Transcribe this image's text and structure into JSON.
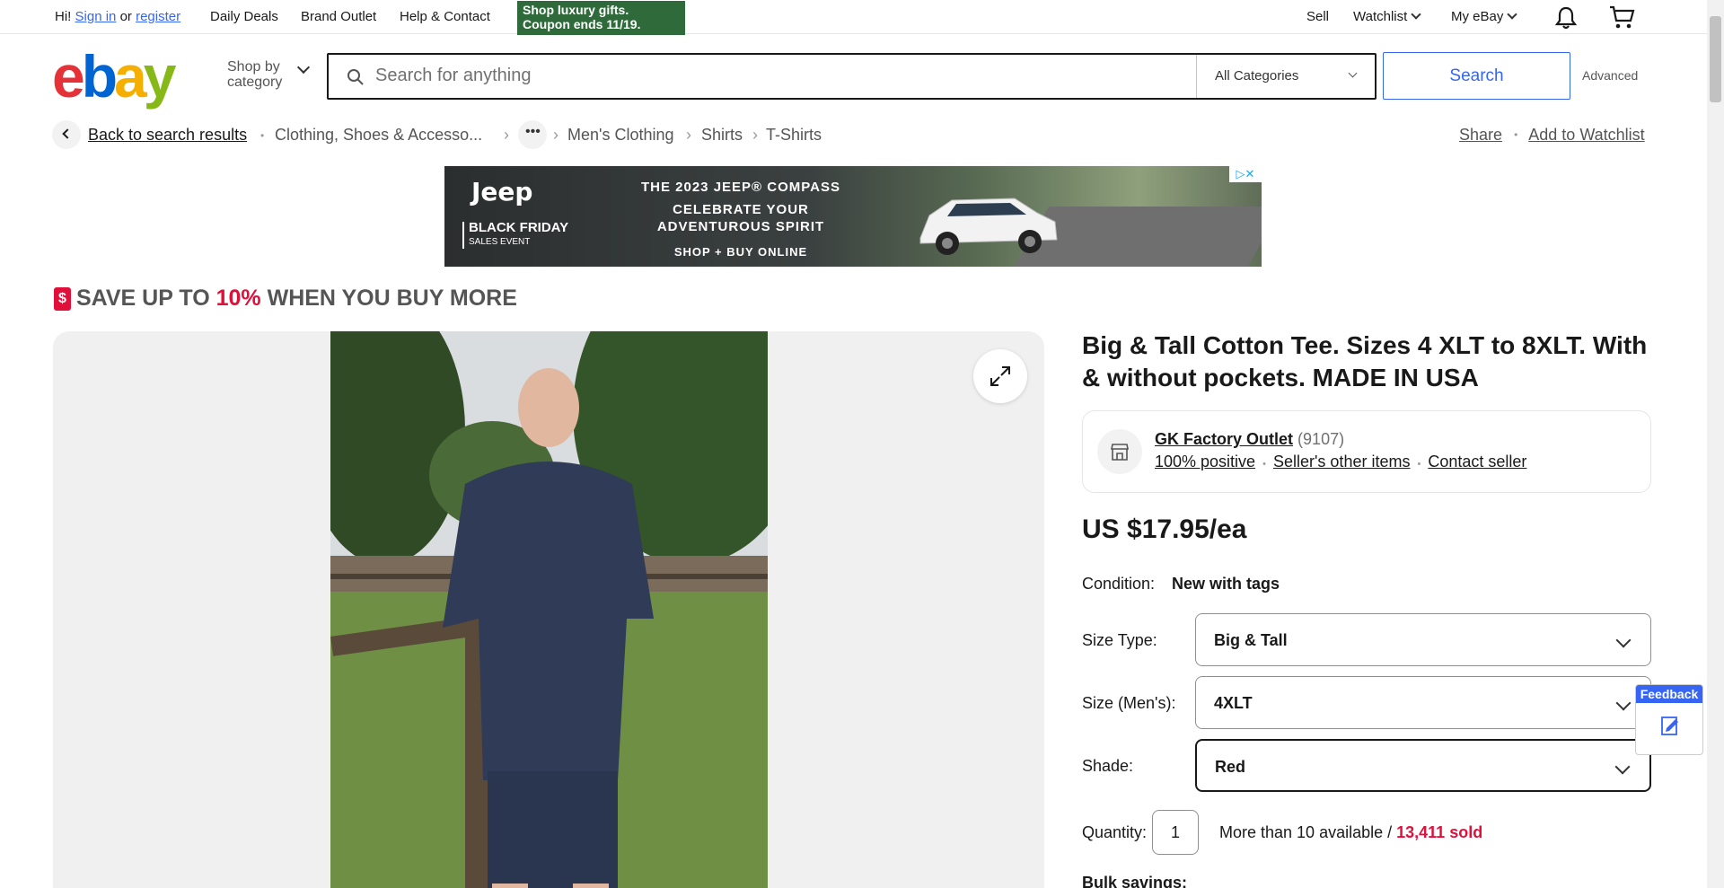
{
  "topbar": {
    "greeting": "Hi!",
    "sign_in": "Sign in",
    "or": "or",
    "register": "register",
    "daily_deals": "Daily Deals",
    "brand_outlet": "Brand Outlet",
    "help_contact": "Help & Contact",
    "promo_line1": "Shop luxury gifts.",
    "promo_line2": "Coupon ends 11/19.",
    "sell": "Sell",
    "watchlist": "Watchlist",
    "my_ebay": "My eBay"
  },
  "header": {
    "logo": [
      "e",
      "b",
      "a",
      "y"
    ],
    "shop_by_line1": "Shop by",
    "shop_by_line2": "category",
    "search_placeholder": "Search for anything",
    "category": "All Categories",
    "search_button": "Search",
    "advanced": "Advanced"
  },
  "breadcrumb": {
    "back": "Back to search results",
    "items": [
      "Clothing, Shoes & Accesso...",
      "Men's Clothing",
      "Shirts",
      "T-Shirts"
    ],
    "share": "Share",
    "add_watchlist": "Add to Watchlist"
  },
  "ad": {
    "brand": "Jeep",
    "event_line1": "BLACK FRIDAY",
    "event_line2": "SALES EVENT",
    "headline1": "THE 2023 JEEP® COMPASS",
    "headline2": "CELEBRATE YOUR",
    "headline3": "ADVENTUROUS SPIRIT",
    "cta": "SHOP + BUY ONLINE"
  },
  "promo_banner": {
    "prefix": "SAVE UP TO ",
    "percent": "10%",
    "suffix": " WHEN YOU BUY MORE"
  },
  "product": {
    "title": "Big & Tall Cotton Tee. Sizes 4 XLT to 8XLT. With & without pockets. MADE IN USA",
    "seller_name": "GK Factory Outlet",
    "seller_score": "(9107)",
    "positive": "100% positive",
    "other_items": "Seller's other items",
    "contact": "Contact seller",
    "price": "US $17.95/ea",
    "condition_label": "Condition:",
    "condition_value": "New with tags",
    "size_type_label": "Size Type:",
    "size_type_value": "Big & Tall",
    "size_label": "Size (Men's):",
    "size_value": "4XLT",
    "shade_label": "Shade:",
    "shade_value": "Red",
    "quantity_label": "Quantity:",
    "quantity_value": "1",
    "available": "More than 10 available / ",
    "sold": "13,411 sold",
    "bulk_label": "Bulk savings:"
  },
  "feedback": {
    "label": "Feedback"
  },
  "colors": {
    "accent": "#3665f3",
    "sale_red": "#e0103a"
  }
}
